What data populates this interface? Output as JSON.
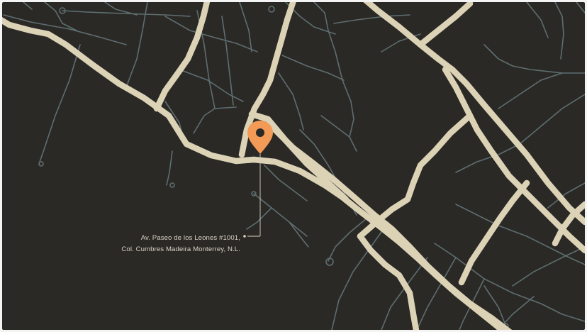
{
  "map": {
    "address_line1": "Av. Paseo de los Leones #1001,",
    "address_line2": "Col. Cumbres Madeira Monterrey, N.L.",
    "marker_icon": "location-pin-icon",
    "colors": {
      "background": "#2b2926",
      "major_road": "#dcd3b6",
      "minor_road": "#5d6e70",
      "marker": "#f29a56",
      "marker_center": "#2b2926",
      "leader_line": "#d8d3c3"
    }
  }
}
